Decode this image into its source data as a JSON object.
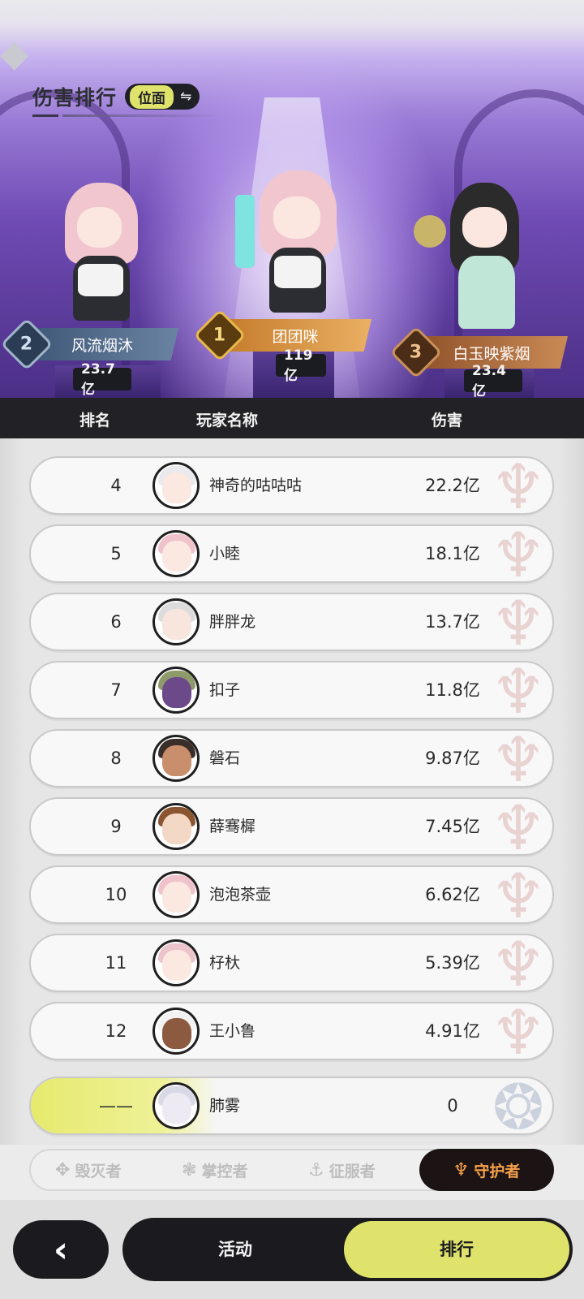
{
  "header": {
    "title": "伤害排行",
    "switch_label": "位面",
    "switch_icon": "⇋"
  },
  "podium": [
    {
      "rank": "2",
      "name": "风流烟沐",
      "score": "23.7亿",
      "medal_color": "#9fb3c9"
    },
    {
      "rank": "1",
      "name": "团团咪",
      "score": "119亿",
      "medal_color": "#e8b84a"
    },
    {
      "rank": "3",
      "name": "白玉映紫烟",
      "score": "23.4亿",
      "medal_color": "#c9905a"
    }
  ],
  "table": {
    "col_rank": "排名",
    "col_player": "玩家名称",
    "col_damage": "伤害"
  },
  "rows": [
    {
      "rank": "4",
      "name": "神奇的咕咕咕",
      "damage": "22.2亿"
    },
    {
      "rank": "5",
      "name": "小睦",
      "damage": "18.1亿"
    },
    {
      "rank": "6",
      "name": "胖胖龙",
      "damage": "13.7亿"
    },
    {
      "rank": "7",
      "name": "扣子",
      "damage": "11.8亿"
    },
    {
      "rank": "8",
      "name": "磐石",
      "damage": "9.87亿"
    },
    {
      "rank": "9",
      "name": "薛骞樨",
      "damage": "7.45亿"
    },
    {
      "rank": "10",
      "name": "泡泡茶壶",
      "damage": "6.62亿"
    },
    {
      "rank": "11",
      "name": "杍杕",
      "damage": "5.39亿"
    },
    {
      "rank": "12",
      "name": "王小鲁",
      "damage": "4.91亿"
    }
  ],
  "my_row": {
    "rank": "——",
    "name": "肺雾",
    "damage": "0"
  },
  "class_tabs": [
    {
      "label": "毁灭者",
      "icon": "destroyer-icon"
    },
    {
      "label": "掌控者",
      "icon": "controller-icon"
    },
    {
      "label": "征服者",
      "icon": "conqueror-icon"
    },
    {
      "label": "守护者",
      "icon": "guardian-icon",
      "active": true
    }
  ],
  "bottom": {
    "back_icon": "‹",
    "tab_activity": "活动",
    "tab_ranking": "排行"
  },
  "colors": {
    "accent": "#dfe36b",
    "dark": "#1b1b1f",
    "guardian_orange": "#f6a04a"
  }
}
